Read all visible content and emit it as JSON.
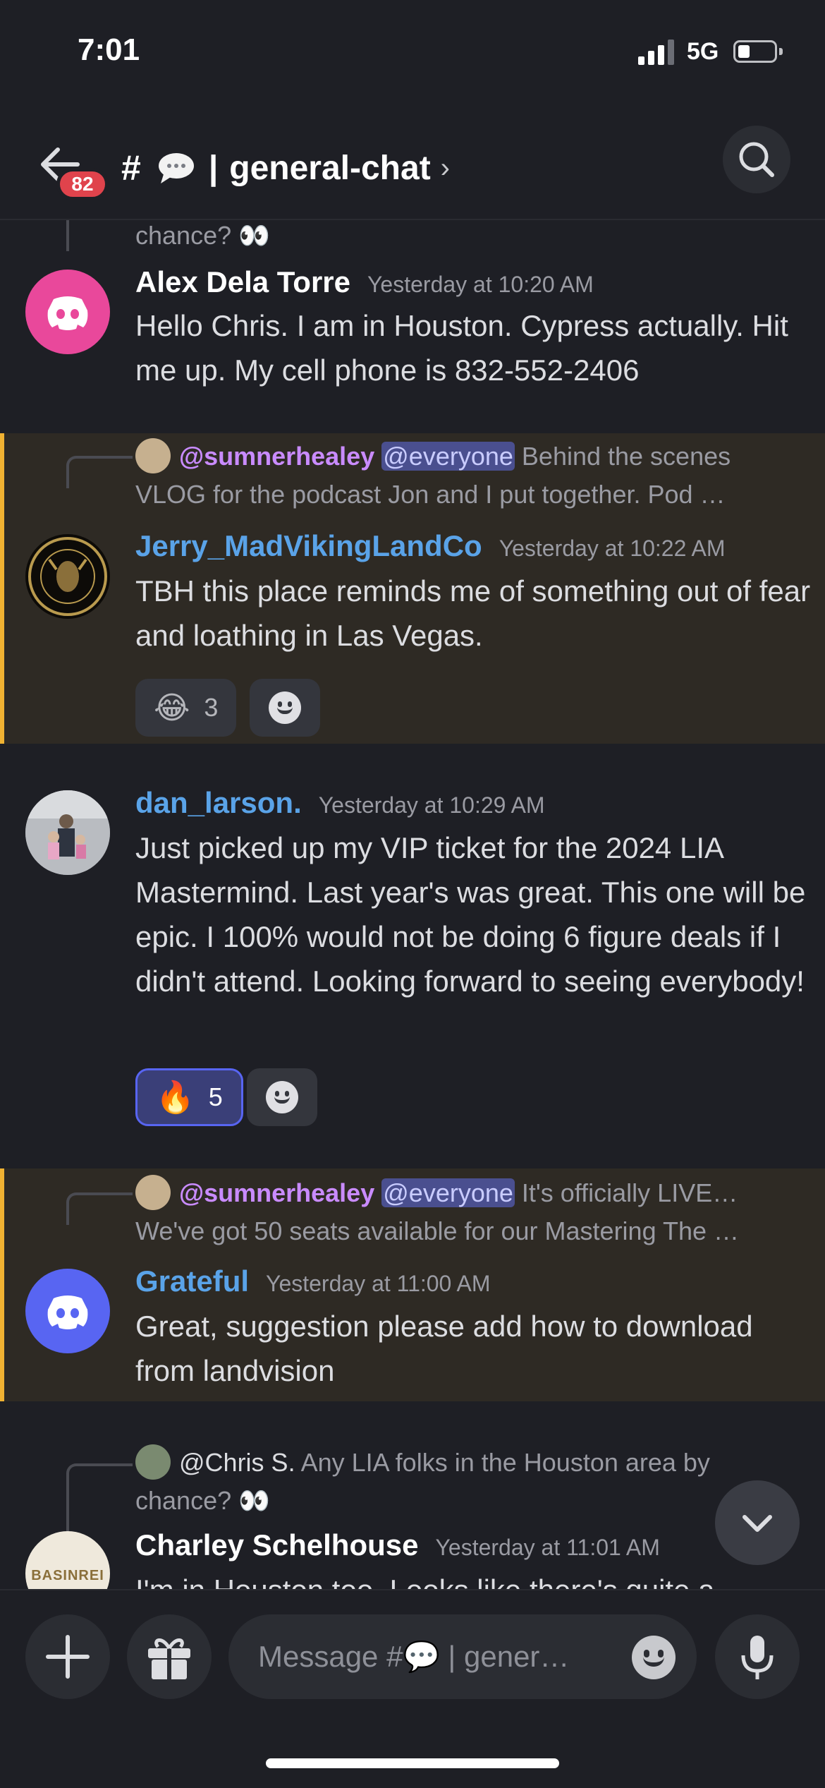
{
  "status_bar": {
    "time": "7:01",
    "network": "5G"
  },
  "header": {
    "unread_badge": "82",
    "channel_hash": "#",
    "channel_separator": "|",
    "channel_name": "general-chat",
    "chevron": "›"
  },
  "colors": {
    "accent": "#5865f2",
    "highlight_bar": "#f0b232",
    "mention": "#c98bff",
    "link_name": "#5aa3e8"
  },
  "messages": [
    {
      "partial_top_text": "chance? 👀",
      "author": "Alex Dela Torre",
      "timestamp": "Yesterday at 10:20 AM",
      "text": "Hello Chris. I am in Houston.  Cypress actually.  Hit me up.  My cell phone is 832-552-2406",
      "avatar_icon": "discord-logo-icon"
    },
    {
      "reply_mention": "@sumnerhealey",
      "reply_everyone": "@everyone",
      "reply_line1": "Behind the scenes",
      "reply_line2": "VLOG for the podcast Jon and I put together.   Pod …",
      "author": "Jerry_MadVikingLandCo",
      "timestamp": "Yesterday at 10:22 AM",
      "text": "TBH this place reminds me of something out of fear and loathing in Las Vegas.",
      "reaction_emoji": "😂",
      "reaction_count": "3"
    },
    {
      "author": "dan_larson.",
      "timestamp": "Yesterday at 10:29 AM",
      "text": "Just picked up my VIP ticket for the 2024 LIA Mastermind. Last year's was great. This one will be epic. I 100% would not be doing 6 figure deals if I didn't attend. Looking forward to seeing everybody!",
      "reaction_emoji": "🔥",
      "reaction_count": "5"
    },
    {
      "reply_mention": "@sumnerhealey",
      "reply_everyone": "@everyone",
      "reply_line1": "It's officially LIVE…",
      "reply_line2": "We've got 50 seats available for our Mastering The …",
      "author": "Grateful",
      "timestamp": "Yesterday at 11:00 AM",
      "text": "Great, suggestion please add how to download from landvision",
      "avatar_icon": "discord-logo-icon"
    },
    {
      "reply_mention": "@Chris S.",
      "reply_line1": "Any LIA folks in the Houston area by",
      "reply_line2": "chance? 👀",
      "author": "Charley Schelhouse",
      "timestamp": "Yesterday at 11:01 AM",
      "text": "I'm in Houston too. Looks like there's quite a",
      "avatar_text": "BASINREI"
    }
  ],
  "composer": {
    "placeholder": "Message #💬 | general-chat"
  }
}
